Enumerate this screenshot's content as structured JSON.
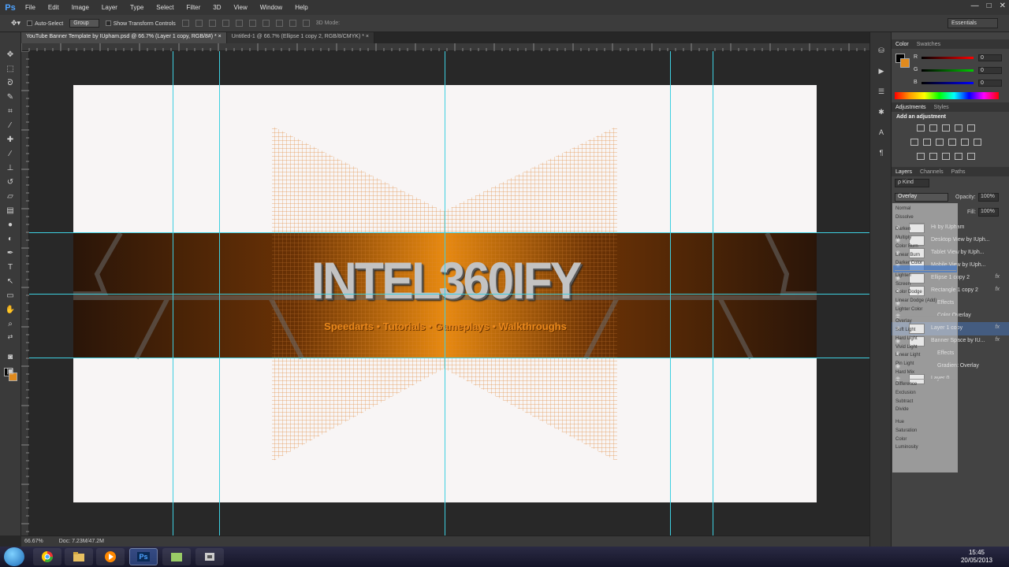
{
  "app": {
    "logo": "Ps"
  },
  "menu": [
    "File",
    "Edit",
    "Image",
    "Layer",
    "Type",
    "Select",
    "Filter",
    "3D",
    "View",
    "Window",
    "Help"
  ],
  "window_controls": {
    "minimize": "—",
    "maximize": "□",
    "close": "✕"
  },
  "options": {
    "auto_select_label": "Auto-Select",
    "auto_select_target": "Group",
    "transform_label": "Show Transform Controls",
    "mode_3d": "3D Mode:",
    "workspace": "Essentials"
  },
  "tabs": [
    {
      "label": "YouTube Banner Template by IUpham.psd @ 66.7% (Layer 1 copy, RGB/8#) *  ×"
    },
    {
      "label": "Untitled-1 @ 66.7% (Ellipse 1 copy 2, RGB/8/CMYK) *  ×"
    }
  ],
  "canvas": {
    "banner_title": "INTEL360IFY",
    "banner_subtitle": "Speedarts • Tutorials • Gameplays • Walkthroughs"
  },
  "status": {
    "zoom": "66.67%",
    "doc": "Doc: 7.23M/47.2M"
  },
  "color_panel": {
    "tabs": [
      "Color",
      "Swatches"
    ],
    "rows": [
      {
        "label": "R",
        "value": "0"
      },
      {
        "label": "G",
        "value": "0"
      },
      {
        "label": "B",
        "value": "0"
      }
    ],
    "colors": {
      "r": "#d22",
      "g": "#2a2",
      "b": "#23c"
    }
  },
  "adjustments": {
    "tabs": [
      "Adjustments",
      "Styles"
    ],
    "heading": "Add an adjustment"
  },
  "layers_panel": {
    "tabs": [
      "Layers",
      "Channels",
      "Paths"
    ],
    "kind_label": "ρ Kind",
    "blend_mode": "Overlay",
    "opacity_label": "Opacity:",
    "opacity_value": "100%",
    "fill_label": "Fill:",
    "fill_value": "100%",
    "layers": [
      {
        "name": "Hi by IUpham",
        "fx": ""
      },
      {
        "name": "Desktop View by IUph...",
        "fx": ""
      },
      {
        "name": "Tablet View by IUph...",
        "fx": ""
      },
      {
        "name": "Mobile View by IUph...",
        "fx": ""
      },
      {
        "name": "Ellipse 1 copy 2",
        "fx": "fx"
      },
      {
        "name": "Rectangle 1 copy 2",
        "fx": "fx"
      },
      {
        "name": "Effects",
        "fx": ""
      },
      {
        "name": "Color Overlay",
        "fx": ""
      },
      {
        "name": "Layer 1 copy",
        "fx": "fx"
      },
      {
        "name": "Banner Space by IU...",
        "fx": "fx"
      },
      {
        "name": "Effects",
        "fx": ""
      },
      {
        "name": "Gradient Overlay",
        "fx": ""
      },
      {
        "name": "Layer 0",
        "fx": ""
      }
    ]
  },
  "blend_menu": {
    "groups": [
      [
        "Normal",
        "Dissolve"
      ],
      [
        "Darken",
        "Multiply",
        "Color Burn",
        "Linear Burn",
        "Darker Color"
      ],
      [
        "Lighten",
        "Screen",
        "Color Dodge",
        "Linear Dodge (Add)",
        "Lighter Color"
      ],
      [
        "Overlay",
        "Soft Light",
        "Hard Light",
        "Vivid Light",
        "Linear Light",
        "Pin Light",
        "Hard Mix"
      ],
      [
        "Difference",
        "Exclusion",
        "Subtract",
        "Divide"
      ],
      [
        "Hue",
        "Saturation",
        "Color",
        "Luminosity"
      ]
    ]
  },
  "taskbar": {
    "apps": [
      "chrome",
      "explorer",
      "media",
      "Ps",
      "folder",
      "tool"
    ],
    "time": "15:45",
    "date": "20/05/2013"
  }
}
